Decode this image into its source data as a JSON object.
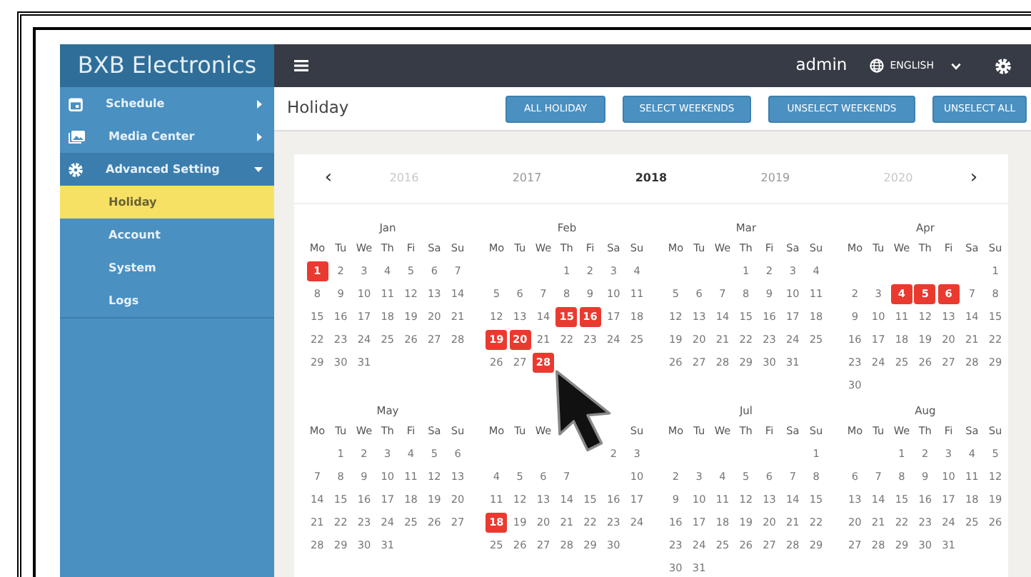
{
  "sidebar": {
    "brand": "BXB Electronics",
    "items": [
      {
        "label": "Schedule",
        "expanded": false
      },
      {
        "label": "Media Center",
        "expanded": false
      },
      {
        "label": "Advanced Setting",
        "expanded": true,
        "children": [
          {
            "label": "Holiday",
            "selected": true
          },
          {
            "label": "Account",
            "selected": false
          },
          {
            "label": "System",
            "selected": false
          },
          {
            "label": "Logs",
            "selected": false
          }
        ]
      }
    ]
  },
  "topbar": {
    "user": "admin",
    "language": "ENGLISH"
  },
  "page": {
    "title": "Holiday",
    "buttons": [
      "ALL HOLIDAY",
      "SELECT WEEKENDS",
      "UNSELECT WEEKENDS",
      "UNSELECT ALL"
    ]
  },
  "calendar": {
    "prev": "‹",
    "next": "›",
    "years": [
      {
        "label": "2016",
        "selected": false,
        "faded": true
      },
      {
        "label": "2017",
        "selected": false,
        "faded": false
      },
      {
        "label": "2018",
        "selected": true,
        "faded": false
      },
      {
        "label": "2019",
        "selected": false,
        "faded": false
      },
      {
        "label": "2020",
        "selected": false,
        "faded": true
      }
    ],
    "months": [
      {
        "name": "Jan",
        "weekdays": [
          {
            "kind": "label",
            "text": "Mo"
          },
          {
            "kind": "label",
            "text": "Tu"
          },
          {
            "kind": "label",
            "text": "We"
          },
          {
            "kind": "label",
            "text": "Th"
          },
          {
            "kind": "label",
            "text": "Fi"
          },
          {
            "kind": "label",
            "text": "Sa"
          },
          {
            "kind": "label",
            "text": "Su"
          }
        ],
        "weeks": [
          [
            {
              "kind": "day",
              "day": "1",
              "selected": true
            },
            {
              "kind": "day",
              "day": "2",
              "selected": false
            },
            {
              "kind": "day",
              "day": "3",
              "selected": false
            },
            {
              "kind": "day",
              "day": "4",
              "selected": false
            },
            {
              "kind": "day",
              "day": "5",
              "selected": false
            },
            {
              "kind": "day",
              "day": "6",
              "selected": false
            },
            {
              "kind": "day",
              "day": "7",
              "selected": false
            }
          ],
          [
            {
              "kind": "day",
              "day": "8",
              "selected": false
            },
            {
              "kind": "day",
              "day": "9",
              "selected": false
            },
            {
              "kind": "day",
              "day": "10",
              "selected": false
            },
            {
              "kind": "day",
              "day": "11",
              "selected": false
            },
            {
              "kind": "day",
              "day": "12",
              "selected": false
            },
            {
              "kind": "day",
              "day": "13",
              "selected": false
            },
            {
              "kind": "day",
              "day": "14",
              "selected": false
            }
          ],
          [
            {
              "kind": "day",
              "day": "15",
              "selected": false
            },
            {
              "kind": "day",
              "day": "16",
              "selected": false
            },
            {
              "kind": "day",
              "day": "17",
              "selected": false
            },
            {
              "kind": "day",
              "day": "18",
              "selected": false
            },
            {
              "kind": "day",
              "day": "19",
              "selected": false
            },
            {
              "kind": "day",
              "day": "20",
              "selected": false
            },
            {
              "kind": "day",
              "day": "21",
              "selected": false
            }
          ],
          [
            {
              "kind": "day",
              "day": "22",
              "selected": false
            },
            {
              "kind": "day",
              "day": "23",
              "selected": false
            },
            {
              "kind": "day",
              "day": "24",
              "selected": false
            },
            {
              "kind": "day",
              "day": "25",
              "selected": false
            },
            {
              "kind": "day",
              "day": "26",
              "selected": false
            },
            {
              "kind": "day",
              "day": "27",
              "selected": false
            },
            {
              "kind": "day",
              "day": "28",
              "selected": false
            }
          ],
          [
            {
              "kind": "day",
              "day": "29",
              "selected": false
            },
            {
              "kind": "day",
              "day": "30",
              "selected": false
            },
            {
              "kind": "day",
              "day": "31",
              "selected": false
            },
            {
              "kind": "blank"
            },
            {
              "kind": "blank"
            },
            {
              "kind": "blank"
            },
            {
              "kind": "blank"
            }
          ]
        ]
      },
      {
        "name": "Feb",
        "weekdays": [
          {
            "kind": "label",
            "text": "Mo"
          },
          {
            "kind": "label",
            "text": "Tu"
          },
          {
            "kind": "label",
            "text": "We"
          },
          {
            "kind": "label",
            "text": "Th"
          },
          {
            "kind": "label",
            "text": "Fi"
          },
          {
            "kind": "label",
            "text": "Sa"
          },
          {
            "kind": "label",
            "text": "Su"
          }
        ],
        "weeks": [
          [
            {
              "kind": "blank"
            },
            {
              "kind": "blank"
            },
            {
              "kind": "blank"
            },
            {
              "kind": "day",
              "day": "1",
              "selected": false
            },
            {
              "kind": "day",
              "day": "2",
              "selected": false
            },
            {
              "kind": "day",
              "day": "3",
              "selected": false
            },
            {
              "kind": "day",
              "day": "4",
              "selected": false
            }
          ],
          [
            {
              "kind": "day",
              "day": "5",
              "selected": false
            },
            {
              "kind": "day",
              "day": "6",
              "selected": false
            },
            {
              "kind": "day",
              "day": "7",
              "selected": false
            },
            {
              "kind": "day",
              "day": "8",
              "selected": false
            },
            {
              "kind": "day",
              "day": "9",
              "selected": false
            },
            {
              "kind": "day",
              "day": "10",
              "selected": false
            },
            {
              "kind": "day",
              "day": "11",
              "selected": false
            }
          ],
          [
            {
              "kind": "day",
              "day": "12",
              "selected": false
            },
            {
              "kind": "day",
              "day": "13",
              "selected": false
            },
            {
              "kind": "day",
              "day": "14",
              "selected": false
            },
            {
              "kind": "day",
              "day": "15",
              "selected": true
            },
            {
              "kind": "day",
              "day": "16",
              "selected": true
            },
            {
              "kind": "day",
              "day": "17",
              "selected": false
            },
            {
              "kind": "day",
              "day": "18",
              "selected": false
            }
          ],
          [
            {
              "kind": "day",
              "day": "19",
              "selected": true
            },
            {
              "kind": "day",
              "day": "20",
              "selected": true
            },
            {
              "kind": "day",
              "day": "21",
              "selected": false
            },
            {
              "kind": "day",
              "day": "22",
              "selected": false
            },
            {
              "kind": "day",
              "day": "23",
              "selected": false
            },
            {
              "kind": "day",
              "day": "24",
              "selected": false
            },
            {
              "kind": "day",
              "day": "25",
              "selected": false
            }
          ],
          [
            {
              "kind": "day",
              "day": "26",
              "selected": false
            },
            {
              "kind": "day",
              "day": "27",
              "selected": false
            },
            {
              "kind": "day",
              "day": "28",
              "selected": true
            },
            {
              "kind": "blank"
            },
            {
              "kind": "blank"
            },
            {
              "kind": "blank"
            },
            {
              "kind": "blank"
            }
          ]
        ]
      },
      {
        "name": "Mar",
        "weekdays": [
          {
            "kind": "label",
            "text": "Mo"
          },
          {
            "kind": "label",
            "text": "Tu"
          },
          {
            "kind": "label",
            "text": "We"
          },
          {
            "kind": "label",
            "text": "Th"
          },
          {
            "kind": "label",
            "text": "Fi"
          },
          {
            "kind": "label",
            "text": "Sa"
          },
          {
            "kind": "label",
            "text": "Su"
          }
        ],
        "weeks": [
          [
            {
              "kind": "blank"
            },
            {
              "kind": "blank"
            },
            {
              "kind": "blank"
            },
            {
              "kind": "day",
              "day": "1",
              "selected": false
            },
            {
              "kind": "day",
              "day": "2",
              "selected": false
            },
            {
              "kind": "day",
              "day": "3",
              "selected": false
            },
            {
              "kind": "day",
              "day": "4",
              "selected": false
            }
          ],
          [
            {
              "kind": "day",
              "day": "5",
              "selected": false
            },
            {
              "kind": "day",
              "day": "6",
              "selected": false
            },
            {
              "kind": "day",
              "day": "7",
              "selected": false
            },
            {
              "kind": "day",
              "day": "8",
              "selected": false
            },
            {
              "kind": "day",
              "day": "9",
              "selected": false
            },
            {
              "kind": "day",
              "day": "10",
              "selected": false
            },
            {
              "kind": "day",
              "day": "11",
              "selected": false
            }
          ],
          [
            {
              "kind": "day",
              "day": "12",
              "selected": false
            },
            {
              "kind": "day",
              "day": "13",
              "selected": false
            },
            {
              "kind": "day",
              "day": "14",
              "selected": false
            },
            {
              "kind": "day",
              "day": "15",
              "selected": false
            },
            {
              "kind": "day",
              "day": "16",
              "selected": false
            },
            {
              "kind": "day",
              "day": "17",
              "selected": false
            },
            {
              "kind": "day",
              "day": "18",
              "selected": false
            }
          ],
          [
            {
              "kind": "day",
              "day": "19",
              "selected": false
            },
            {
              "kind": "day",
              "day": "20",
              "selected": false
            },
            {
              "kind": "day",
              "day": "21",
              "selected": false
            },
            {
              "kind": "day",
              "day": "22",
              "selected": false
            },
            {
              "kind": "day",
              "day": "23",
              "selected": false
            },
            {
              "kind": "day",
              "day": "24",
              "selected": false
            },
            {
              "kind": "day",
              "day": "25",
              "selected": false
            }
          ],
          [
            {
              "kind": "day",
              "day": "26",
              "selected": false
            },
            {
              "kind": "day",
              "day": "27",
              "selected": false
            },
            {
              "kind": "day",
              "day": "28",
              "selected": false
            },
            {
              "kind": "day",
              "day": "29",
              "selected": false
            },
            {
              "kind": "day",
              "day": "30",
              "selected": false
            },
            {
              "kind": "day",
              "day": "31",
              "selected": false
            },
            {
              "kind": "blank"
            }
          ]
        ]
      },
      {
        "name": "Apr",
        "weekdays": [
          {
            "kind": "label",
            "text": "Mo"
          },
          {
            "kind": "label",
            "text": "Tu"
          },
          {
            "kind": "label",
            "text": "We"
          },
          {
            "kind": "label",
            "text": "Th"
          },
          {
            "kind": "label",
            "text": "Fi"
          },
          {
            "kind": "label",
            "text": "Sa"
          },
          {
            "kind": "label",
            "text": "Su"
          }
        ],
        "weeks": [
          [
            {
              "kind": "blank"
            },
            {
              "kind": "blank"
            },
            {
              "kind": "blank"
            },
            {
              "kind": "blank"
            },
            {
              "kind": "blank"
            },
            {
              "kind": "blank"
            },
            {
              "kind": "day",
              "day": "1",
              "selected": false
            }
          ],
          [
            {
              "kind": "day",
              "day": "2",
              "selected": false
            },
            {
              "kind": "day",
              "day": "3",
              "selected": false
            },
            {
              "kind": "day",
              "day": "4",
              "selected": true
            },
            {
              "kind": "day",
              "day": "5",
              "selected": true
            },
            {
              "kind": "day",
              "day": "6",
              "selected": true
            },
            {
              "kind": "day",
              "day": "7",
              "selected": false
            },
            {
              "kind": "day",
              "day": "8",
              "selected": false
            }
          ],
          [
            {
              "kind": "day",
              "day": "9",
              "selected": false
            },
            {
              "kind": "day",
              "day": "10",
              "selected": false
            },
            {
              "kind": "day",
              "day": "11",
              "selected": false
            },
            {
              "kind": "day",
              "day": "12",
              "selected": false
            },
            {
              "kind": "day",
              "day": "13",
              "selected": false
            },
            {
              "kind": "day",
              "day": "14",
              "selected": false
            },
            {
              "kind": "day",
              "day": "15",
              "selected": false
            }
          ],
          [
            {
              "kind": "day",
              "day": "16",
              "selected": false
            },
            {
              "kind": "day",
              "day": "17",
              "selected": false
            },
            {
              "kind": "day",
              "day": "18",
              "selected": false
            },
            {
              "kind": "day",
              "day": "19",
              "selected": false
            },
            {
              "kind": "day",
              "day": "20",
              "selected": false
            },
            {
              "kind": "day",
              "day": "21",
              "selected": false
            },
            {
              "kind": "day",
              "day": "22",
              "selected": false
            }
          ],
          [
            {
              "kind": "day",
              "day": "23",
              "selected": false
            },
            {
              "kind": "day",
              "day": "24",
              "selected": false
            },
            {
              "kind": "day",
              "day": "25",
              "selected": false
            },
            {
              "kind": "day",
              "day": "26",
              "selected": false
            },
            {
              "kind": "day",
              "day": "27",
              "selected": false
            },
            {
              "kind": "day",
              "day": "28",
              "selected": false
            },
            {
              "kind": "day",
              "day": "29",
              "selected": false
            }
          ],
          [
            {
              "kind": "day",
              "day": "30",
              "selected": false
            },
            {
              "kind": "blank"
            },
            {
              "kind": "blank"
            },
            {
              "kind": "blank"
            },
            {
              "kind": "blank"
            },
            {
              "kind": "blank"
            },
            {
              "kind": "blank"
            }
          ]
        ]
      },
      {
        "name": "May",
        "weekdays": [
          {
            "kind": "label",
            "text": "Mo"
          },
          {
            "kind": "label",
            "text": "Tu"
          },
          {
            "kind": "label",
            "text": "We"
          },
          {
            "kind": "label",
            "text": "Th"
          },
          {
            "kind": "label",
            "text": "Fi"
          },
          {
            "kind": "label",
            "text": "Sa"
          },
          {
            "kind": "label",
            "text": "Su"
          }
        ],
        "weeks": [
          [
            {
              "kind": "blank"
            },
            {
              "kind": "day",
              "day": "1",
              "selected": false
            },
            {
              "kind": "day",
              "day": "2",
              "selected": false
            },
            {
              "kind": "day",
              "day": "3",
              "selected": false
            },
            {
              "kind": "day",
              "day": "4",
              "selected": false
            },
            {
              "kind": "day",
              "day": "5",
              "selected": false
            },
            {
              "kind": "day",
              "day": "6",
              "selected": false
            }
          ],
          [
            {
              "kind": "day",
              "day": "7",
              "selected": false
            },
            {
              "kind": "day",
              "day": "8",
              "selected": false
            },
            {
              "kind": "day",
              "day": "9",
              "selected": false
            },
            {
              "kind": "day",
              "day": "10",
              "selected": false
            },
            {
              "kind": "day",
              "day": "11",
              "selected": false
            },
            {
              "kind": "day",
              "day": "12",
              "selected": false
            },
            {
              "kind": "day",
              "day": "13",
              "selected": false
            }
          ],
          [
            {
              "kind": "day",
              "day": "14",
              "selected": false
            },
            {
              "kind": "day",
              "day": "15",
              "selected": false
            },
            {
              "kind": "day",
              "day": "16",
              "selected": false
            },
            {
              "kind": "day",
              "day": "17",
              "selected": false
            },
            {
              "kind": "day",
              "day": "18",
              "selected": false
            },
            {
              "kind": "day",
              "day": "19",
              "selected": false
            },
            {
              "kind": "day",
              "day": "20",
              "selected": false
            }
          ],
          [
            {
              "kind": "day",
              "day": "21",
              "selected": false
            },
            {
              "kind": "day",
              "day": "22",
              "selected": false
            },
            {
              "kind": "day",
              "day": "23",
              "selected": false
            },
            {
              "kind": "day",
              "day": "24",
              "selected": false
            },
            {
              "kind": "day",
              "day": "25",
              "selected": false
            },
            {
              "kind": "day",
              "day": "26",
              "selected": false
            },
            {
              "kind": "day",
              "day": "27",
              "selected": false
            }
          ],
          [
            {
              "kind": "day",
              "day": "28",
              "selected": false
            },
            {
              "kind": "day",
              "day": "29",
              "selected": false
            },
            {
              "kind": "day",
              "day": "30",
              "selected": false
            },
            {
              "kind": "day",
              "day": "31",
              "selected": false
            },
            {
              "kind": "blank"
            },
            {
              "kind": "blank"
            },
            {
              "kind": "blank"
            }
          ]
        ]
      },
      {
        "weekdays": [
          {
            "kind": "label",
            "text": "Mo"
          },
          {
            "kind": "label",
            "text": "Tu"
          },
          {
            "kind": "label",
            "text": "We"
          },
          {
            "kind": "hidden"
          },
          {
            "kind": "hidden"
          },
          {
            "kind": "hidden"
          },
          {
            "kind": "label",
            "text": "Su"
          }
        ],
        "weeks": [
          [
            {
              "kind": "blank"
            },
            {
              "kind": "blank"
            },
            {
              "kind": "blank"
            },
            {
              "kind": "blank"
            },
            {
              "kind": "hidden"
            },
            {
              "kind": "day",
              "day": "2",
              "selected": false
            },
            {
              "kind": "day",
              "day": "3",
              "selected": false
            }
          ],
          [
            {
              "kind": "day",
              "day": "4",
              "selected": false
            },
            {
              "kind": "day",
              "day": "5",
              "selected": false
            },
            {
              "kind": "day",
              "day": "6",
              "selected": false
            },
            {
              "kind": "day",
              "day": "7",
              "selected": false
            },
            {
              "kind": "hidden"
            },
            {
              "kind": "hidden"
            },
            {
              "kind": "day",
              "day": "10",
              "selected": false
            }
          ],
          [
            {
              "kind": "day",
              "day": "11",
              "selected": false
            },
            {
              "kind": "day",
              "day": "12",
              "selected": false
            },
            {
              "kind": "day",
              "day": "13",
              "selected": false
            },
            {
              "kind": "day",
              "day": "14",
              "selected": false
            },
            {
              "kind": "day",
              "day": "15",
              "selected": false
            },
            {
              "kind": "day",
              "day": "16",
              "selected": false
            },
            {
              "kind": "day",
              "day": "17",
              "selected": false
            }
          ],
          [
            {
              "kind": "day",
              "day": "18",
              "selected": true
            },
            {
              "kind": "day",
              "day": "19",
              "selected": false
            },
            {
              "kind": "day",
              "day": "20",
              "selected": false
            },
            {
              "kind": "day",
              "day": "21",
              "selected": false
            },
            {
              "kind": "day",
              "day": "22",
              "selected": false
            },
            {
              "kind": "day",
              "day": "23",
              "selected": false
            },
            {
              "kind": "day",
              "day": "24",
              "selected": false
            }
          ],
          [
            {
              "kind": "day",
              "day": "25",
              "selected": false
            },
            {
              "kind": "day",
              "day": "26",
              "selected": false
            },
            {
              "kind": "day",
              "day": "27",
              "selected": false
            },
            {
              "kind": "day",
              "day": "28",
              "selected": false
            },
            {
              "kind": "day",
              "day": "29",
              "selected": false
            },
            {
              "kind": "day",
              "day": "30",
              "selected": false
            },
            {
              "kind": "blank"
            }
          ]
        ]
      },
      {
        "name": "Jul",
        "weekdays": [
          {
            "kind": "label",
            "text": "Mo"
          },
          {
            "kind": "label",
            "text": "Tu"
          },
          {
            "kind": "label",
            "text": "We"
          },
          {
            "kind": "label",
            "text": "Th"
          },
          {
            "kind": "label",
            "text": "Fi"
          },
          {
            "kind": "label",
            "text": "Sa"
          },
          {
            "kind": "label",
            "text": "Su"
          }
        ],
        "weeks": [
          [
            {
              "kind": "blank"
            },
            {
              "kind": "blank"
            },
            {
              "kind": "blank"
            },
            {
              "kind": "blank"
            },
            {
              "kind": "blank"
            },
            {
              "kind": "blank"
            },
            {
              "kind": "day",
              "day": "1",
              "selected": false
            }
          ],
          [
            {
              "kind": "day",
              "day": "2",
              "selected": false
            },
            {
              "kind": "day",
              "day": "3",
              "selected": false
            },
            {
              "kind": "day",
              "day": "4",
              "selected": false
            },
            {
              "kind": "day",
              "day": "5",
              "selected": false
            },
            {
              "kind": "day",
              "day": "6",
              "selected": false
            },
            {
              "kind": "day",
              "day": "7",
              "selected": false
            },
            {
              "kind": "day",
              "day": "8",
              "selected": false
            }
          ],
          [
            {
              "kind": "day",
              "day": "9",
              "selected": false
            },
            {
              "kind": "day",
              "day": "10",
              "selected": false
            },
            {
              "kind": "day",
              "day": "11",
              "selected": false
            },
            {
              "kind": "day",
              "day": "12",
              "selected": false
            },
            {
              "kind": "day",
              "day": "13",
              "selected": false
            },
            {
              "kind": "day",
              "day": "14",
              "selected": false
            },
            {
              "kind": "day",
              "day": "15",
              "selected": false
            }
          ],
          [
            {
              "kind": "day",
              "day": "16",
              "selected": false
            },
            {
              "kind": "day",
              "day": "17",
              "selected": false
            },
            {
              "kind": "day",
              "day": "18",
              "selected": false
            },
            {
              "kind": "day",
              "day": "19",
              "selected": false
            },
            {
              "kind": "day",
              "day": "20",
              "selected": false
            },
            {
              "kind": "day",
              "day": "21",
              "selected": false
            },
            {
              "kind": "day",
              "day": "22",
              "selected": false
            }
          ],
          [
            {
              "kind": "day",
              "day": "23",
              "selected": false
            },
            {
              "kind": "day",
              "day": "24",
              "selected": false
            },
            {
              "kind": "day",
              "day": "25",
              "selected": false
            },
            {
              "kind": "day",
              "day": "26",
              "selected": false
            },
            {
              "kind": "day",
              "day": "27",
              "selected": false
            },
            {
              "kind": "day",
              "day": "28",
              "selected": false
            },
            {
              "kind": "day",
              "day": "29",
              "selected": false
            }
          ],
          [
            {
              "kind": "day",
              "day": "30",
              "selected": false
            },
            {
              "kind": "day",
              "day": "31",
              "selected": false
            },
            {
              "kind": "blank"
            },
            {
              "kind": "blank"
            },
            {
              "kind": "blank"
            },
            {
              "kind": "blank"
            },
            {
              "kind": "blank"
            }
          ]
        ]
      },
      {
        "name": "Aug",
        "weekdays": [
          {
            "kind": "label",
            "text": "Mo"
          },
          {
            "kind": "label",
            "text": "Tu"
          },
          {
            "kind": "label",
            "text": "We"
          },
          {
            "kind": "label",
            "text": "Th"
          },
          {
            "kind": "label",
            "text": "Fi"
          },
          {
            "kind": "label",
            "text": "Sa"
          },
          {
            "kind": "label",
            "text": "Su"
          }
        ],
        "weeks": [
          [
            {
              "kind": "blank"
            },
            {
              "kind": "blank"
            },
            {
              "kind": "day",
              "day": "1",
              "selected": false
            },
            {
              "kind": "day",
              "day": "2",
              "selected": false
            },
            {
              "kind": "day",
              "day": "3",
              "selected": false
            },
            {
              "kind": "day",
              "day": "4",
              "selected": false
            },
            {
              "kind": "day",
              "day": "5",
              "selected": false
            }
          ],
          [
            {
              "kind": "day",
              "day": "6",
              "selected": false
            },
            {
              "kind": "day",
              "day": "7",
              "selected": false
            },
            {
              "kind": "day",
              "day": "8",
              "selected": false
            },
            {
              "kind": "day",
              "day": "9",
              "selected": false
            },
            {
              "kind": "day",
              "day": "10",
              "selected": false
            },
            {
              "kind": "day",
              "day": "11",
              "selected": false
            },
            {
              "kind": "day",
              "day": "12",
              "selected": false
            }
          ],
          [
            {
              "kind": "day",
              "day": "13",
              "selected": false
            },
            {
              "kind": "day",
              "day": "14",
              "selected": false
            },
            {
              "kind": "day",
              "day": "15",
              "selected": false
            },
            {
              "kind": "day",
              "day": "16",
              "selected": false
            },
            {
              "kind": "day",
              "day": "17",
              "selected": false
            },
            {
              "kind": "day",
              "day": "18",
              "selected": false
            },
            {
              "kind": "day",
              "day": "19",
              "selected": false
            }
          ],
          [
            {
              "kind": "day",
              "day": "20",
              "selected": false
            },
            {
              "kind": "day",
              "day": "21",
              "selected": false
            },
            {
              "kind": "day",
              "day": "22",
              "selected": false
            },
            {
              "kind": "day",
              "day": "23",
              "selected": false
            },
            {
              "kind": "day",
              "day": "24",
              "selected": false
            },
            {
              "kind": "day",
              "day": "25",
              "selected": false
            },
            {
              "kind": "day",
              "day": "26",
              "selected": false
            }
          ],
          [
            {
              "kind": "day",
              "day": "27",
              "selected": false
            },
            {
              "kind": "day",
              "day": "28",
              "selected": false
            },
            {
              "kind": "day",
              "day": "29",
              "selected": false
            },
            {
              "kind": "day",
              "day": "30",
              "selected": false
            },
            {
              "kind": "day",
              "day": "31",
              "selected": false
            },
            {
              "kind": "blank"
            },
            {
              "kind": "blank"
            }
          ]
        ]
      }
    ]
  }
}
